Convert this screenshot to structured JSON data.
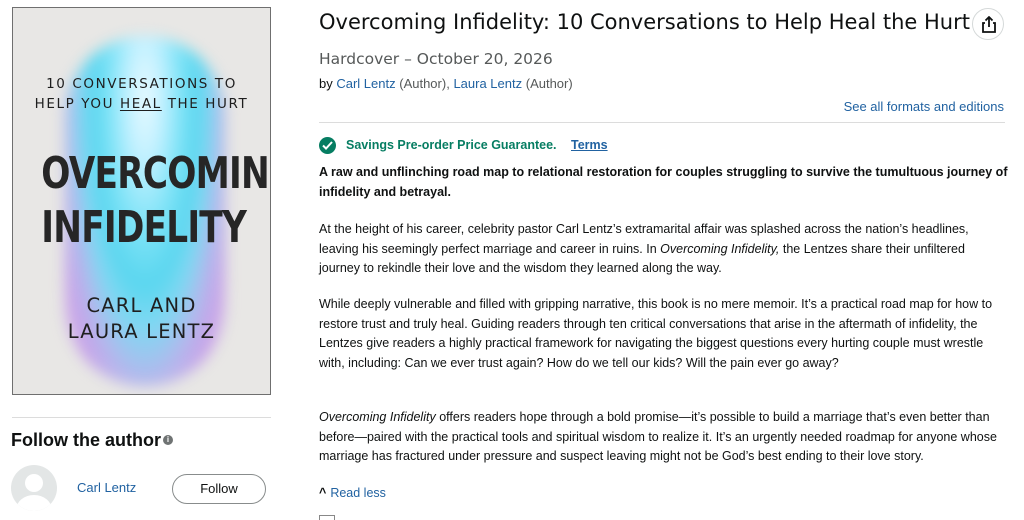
{
  "cover": {
    "subtitle_line1": "10 CONVERSATIONS TO",
    "subtitle_line2_pre": "HELP YOU ",
    "subtitle_line2_em": "HEAL",
    "subtitle_line2_post": " THE HURT",
    "title_line1": "OVERCOMING",
    "title_line2": "INFIDELITY",
    "author_line1": "CARL AND",
    "author_line2": "LAURA LENTZ"
  },
  "follow": {
    "heading": "Follow the author",
    "author_name": "Carl Lentz",
    "button_label": "Follow"
  },
  "product": {
    "title": "Overcoming Infidelity: 10 Conversations to Help Heal the Hurt",
    "format": "Hardcover – October 20, 2026",
    "by": "by",
    "author1": "Carl Lentz",
    "author1_role": "(Author),",
    "author2": "Laura Lentz",
    "author2_role": "(Author)",
    "see_formats": "See all formats and editions"
  },
  "guarantee": {
    "text": "Savings Pre-order Price Guarantee.",
    "terms": "Terms"
  },
  "description": {
    "bold": "A raw and unflinching road map to relational restoration for couples struggling to survive the tumultuous journey of infidelity and betrayal.",
    "p1_a": "At the height of his career, celebrity pastor Carl Lentz’s extramarital affair was splashed across the nation’s headlines, leaving his seemingly perfect marriage and career in ruins. In ",
    "p1_em": "Overcoming Infidelity,",
    "p1_b": " the Lentzes share their unfiltered journey to rekindle their love and the wisdom they learned along the way.",
    "p2": "While deeply vulnerable and filled with gripping narrative, this book is no mere memoir. It’s a practical road map for how to restore trust and truly heal. Guiding readers through ten critical conversations that arise in the aftermath of infidelity, the Lentzes give readers a highly practical framework for navigating the biggest questions every hurting couple must wrestle with, including: Can we ever trust again? How do we tell our kids? Will the pain ever go away?",
    "p3_em": "Overcoming Infidelity",
    "p3_b": " offers readers hope through a bold promise—it’s possible to build a marriage that’s even better than before—paired with the practical tools and spiritual wisdom to realize it. It’s an urgently needed roadmap for anyone whose marriage has fractured under pressure and suspect leaving might not be God’s best ending to their love story.",
    "read_less": "Read less"
  },
  "colors": {
    "link": "#2162a1",
    "success": "#067d62",
    "text": "#0f1111",
    "muted": "#565959"
  }
}
